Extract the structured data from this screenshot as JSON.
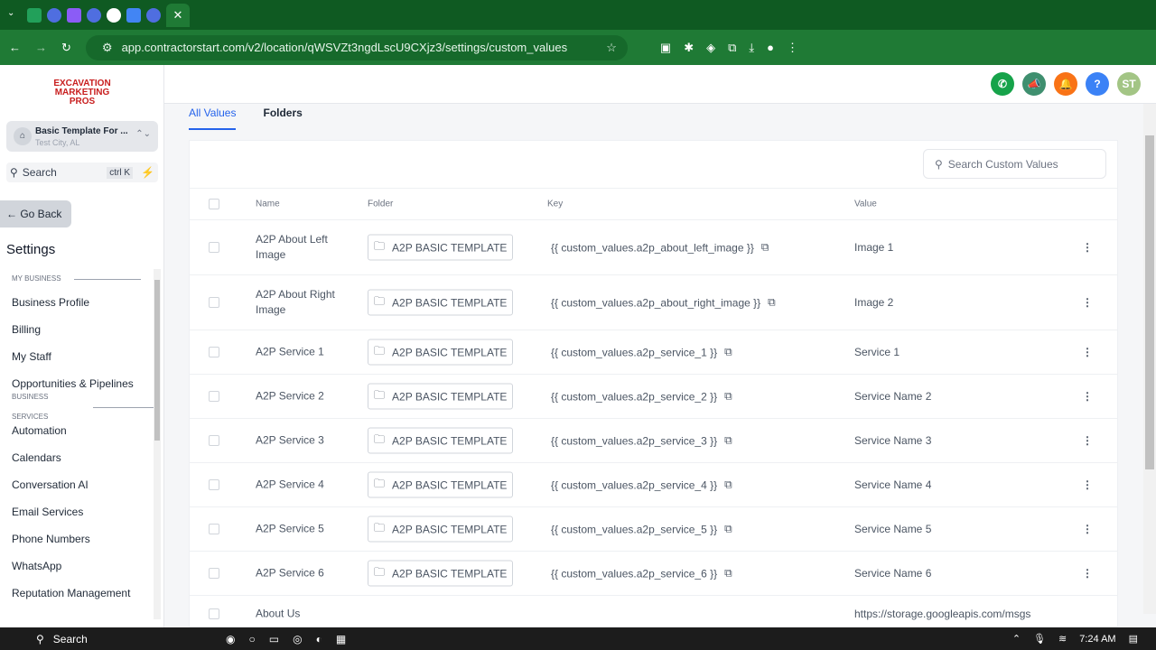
{
  "browser": {
    "url": "app.contractorstart.com/v2/location/qWSVZt3ngdLscU9CXjz3/settings/custom_values",
    "active_tab_close": "✕"
  },
  "sidebar": {
    "logo": "EXCAVATION MARKETING PROS",
    "location_name": "Basic Template For ...",
    "location_city": "Test City, AL",
    "search_label": "Search",
    "search_shortcut": "ctrl K",
    "go_back": "Go Back",
    "title": "Settings",
    "sections": [
      {
        "label": "MY BUSINESS",
        "items": [
          "Business Profile",
          "Billing",
          "My Staff",
          "Opportunities & Pipelines"
        ]
      },
      {
        "label": "BUSINESS SERVICES",
        "items": [
          "Automation",
          "Calendars",
          "Conversation AI",
          "Email Services",
          "Phone Numbers",
          "WhatsApp",
          "Reputation Management"
        ]
      }
    ]
  },
  "header": {
    "avatar_initials": "ST",
    "help": "?"
  },
  "tabs": [
    "All Values",
    "Folders"
  ],
  "search": {
    "placeholder": "Search Custom Values"
  },
  "table": {
    "columns": [
      "Name",
      "Folder",
      "Key",
      "Value"
    ],
    "rows": [
      {
        "name": "A2P About Left Image",
        "folder": "A2P BASIC TEMPLATE",
        "key": "{{ custom_values.a2p_about_left_image }}",
        "value": "Image 1"
      },
      {
        "name": "A2P About Right Image",
        "folder": "A2P BASIC TEMPLATE",
        "key": "{{ custom_values.a2p_about_right_image }}",
        "value": "Image 2"
      },
      {
        "name": "A2P Service 1",
        "folder": "A2P BASIC TEMPLATE",
        "key": "{{ custom_values.a2p_service_1 }}",
        "value": "Service 1"
      },
      {
        "name": "A2P Service 2",
        "folder": "A2P BASIC TEMPLATE",
        "key": "{{ custom_values.a2p_service_2 }}",
        "value": "Service Name 2"
      },
      {
        "name": "A2P Service 3",
        "folder": "A2P BASIC TEMPLATE",
        "key": "{{ custom_values.a2p_service_3 }}",
        "value": "Service Name 3"
      },
      {
        "name": "A2P Service 4",
        "folder": "A2P BASIC TEMPLATE",
        "key": "{{ custom_values.a2p_service_4 }}",
        "value": "Service Name 4"
      },
      {
        "name": "A2P Service 5",
        "folder": "A2P BASIC TEMPLATE",
        "key": "{{ custom_values.a2p_service_5 }}",
        "value": "Service Name 5"
      },
      {
        "name": "A2P Service 6",
        "folder": "A2P BASIC TEMPLATE",
        "key": "{{ custom_values.a2p_service_6 }}",
        "value": "Service Name 6"
      },
      {
        "name": "About Us",
        "folder": "",
        "key": "",
        "value": "https://storage.googleapis.com/msgs"
      }
    ]
  },
  "taskbar": {
    "search": "Search",
    "time": "7:24 AM"
  },
  "colors": {
    "accent": "#2563eb",
    "browser": "#1f7a35",
    "phone": "#16a34a",
    "notify": "#f97316",
    "help": "#3b82f6",
    "avatar": "#a3c585"
  }
}
